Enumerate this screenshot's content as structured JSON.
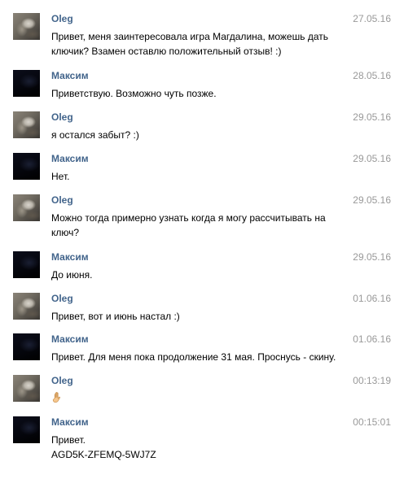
{
  "messages": [
    {
      "sender": "Oleg",
      "avatar": "oleg-avatar",
      "time": "27.05.16",
      "lines": [
        "Привет, меня заинтересовала игра Магдалина, можешь дать",
        "ключик? Взамен оставлю положительный отзыв! :)"
      ]
    },
    {
      "sender": "Максим",
      "avatar": "maxim-avatar",
      "time": "28.05.16",
      "lines": [
        "Приветствую. Возможно чуть позже."
      ]
    },
    {
      "sender": "Oleg",
      "avatar": "oleg-avatar",
      "time": "29.05.16",
      "lines": [
        "я остался забыт? :)"
      ]
    },
    {
      "sender": "Максим",
      "avatar": "maxim-avatar",
      "time": "29.05.16",
      "lines": [
        "Нет."
      ]
    },
    {
      "sender": "Oleg",
      "avatar": "oleg-avatar",
      "time": "29.05.16",
      "lines": [
        "Можно тогда примерно узнать когда я могу рассчитывать на",
        "ключ?"
      ]
    },
    {
      "sender": "Максим",
      "avatar": "maxim-avatar",
      "time": "29.05.16",
      "lines": [
        "До июня."
      ]
    },
    {
      "sender": "Oleg",
      "avatar": "oleg-avatar",
      "time": "01.06.16",
      "lines": [
        "Привет, вот и июнь настал :)"
      ]
    },
    {
      "sender": "Максим",
      "avatar": "maxim-avatar",
      "time": "01.06.16",
      "lines": [
        "Привет. Для меня пока продолжение 31 мая. Проснусь - скину."
      ]
    },
    {
      "sender": "Oleg",
      "avatar": "oleg-avatar",
      "time": "00:13:19",
      "lines": [],
      "emoji": "raised-hand-icon"
    },
    {
      "sender": "Максим",
      "avatar": "maxim-avatar",
      "time": "00:15:01",
      "lines": [
        "Привет.",
        "AGD5K-ZFEMQ-5WJ7Z"
      ]
    }
  ],
  "colors": {
    "name": "#42648b",
    "time": "#999999",
    "text": "#000000",
    "background": "#ffffff"
  }
}
